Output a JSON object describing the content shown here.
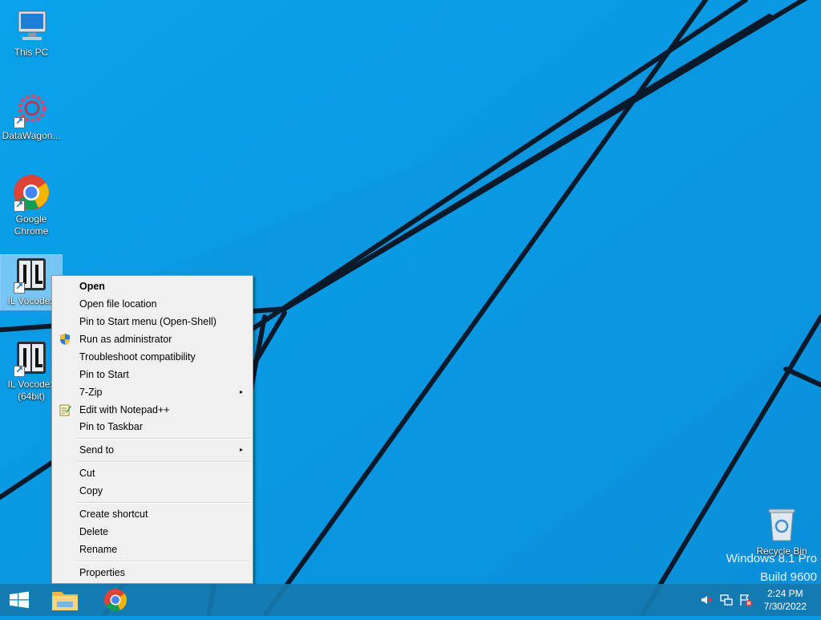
{
  "desktop": {
    "icons": [
      {
        "label_line1": "This PC",
        "label_line2": ""
      },
      {
        "label_line1": "DataWagon...",
        "label_line2": ""
      },
      {
        "label_line1": "Google",
        "label_line2": "Chrome"
      },
      {
        "label_line1": "IL Vocodex",
        "label_line2": ""
      },
      {
        "label_line1": "IL Vocodex",
        "label_line2": "(64bit)"
      },
      {
        "label_line1": "Recycle Bin",
        "label_line2": ""
      }
    ],
    "watermark": {
      "line1": "Windows 8.1 Pro",
      "line2": "Build 9600"
    }
  },
  "context_menu": {
    "items": [
      {
        "label": "Open"
      },
      {
        "label": "Open file location"
      },
      {
        "label": "Pin to Start menu (Open-Shell)"
      },
      {
        "label": "Run as administrator",
        "icon": "uac-shield-icon"
      },
      {
        "label": "Troubleshoot compatibility"
      },
      {
        "label": "Pin to Start"
      },
      {
        "label": "7-Zip"
      },
      {
        "label": "Edit with Notepad++",
        "icon": "notepad-plus-icon"
      },
      {
        "label": "Pin to Taskbar"
      },
      {
        "label": "Send to"
      },
      {
        "label": "Cut"
      },
      {
        "label": "Copy"
      },
      {
        "label": "Create shortcut"
      },
      {
        "label": "Delete"
      },
      {
        "label": "Rename"
      },
      {
        "label": "Properties"
      }
    ],
    "submenu_arrow": "▸"
  },
  "taskbar": {
    "buttons": [
      "start-button-icon",
      "file-explorer-icon",
      "chrome-icon"
    ],
    "tray_icons": [
      "volume-muted-icon",
      "network-icon",
      "action-center-flag-icon"
    ],
    "clock": {
      "time": "2:24 PM",
      "date": "7/30/2022"
    }
  },
  "colors": {
    "wallpaper": "#0a98e4",
    "taskbar": "#1678af",
    "menu_bg": "#f0f0f0"
  }
}
